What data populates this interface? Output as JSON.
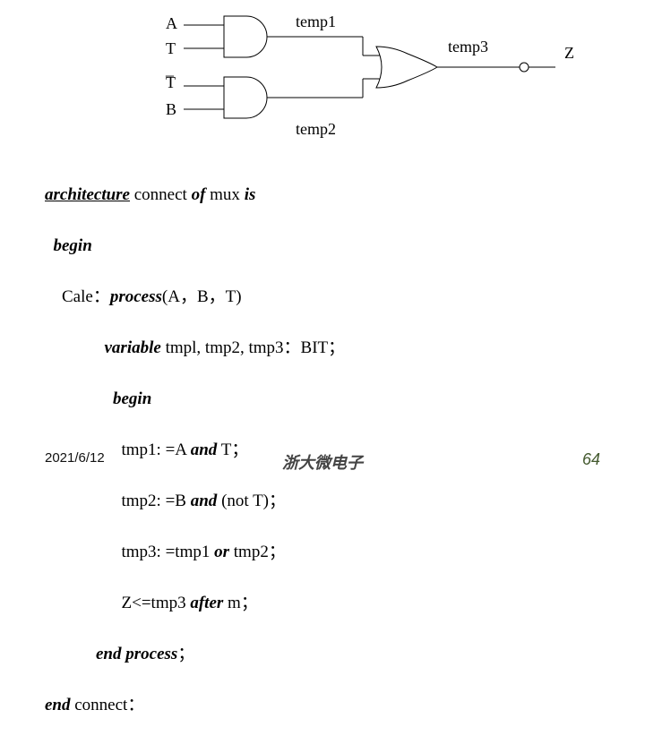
{
  "diagram": {
    "inputs": {
      "A": "A",
      "T": "T",
      "TbarTop": "_",
      "Tbar": "T",
      "B": "B"
    },
    "signals": {
      "temp1": "temp1",
      "temp2": "temp2",
      "temp3": "temp3"
    },
    "output": "Z"
  },
  "code": {
    "kw_architecture": "architecture",
    "txt_connect": " connect ",
    "kw_of": "of",
    "txt_mux": " mux ",
    "kw_is": "is",
    "kw_begin1": "begin",
    "txt_cale": "Cale：",
    "kw_process": "process",
    "txt_processargs": "(A，B，T)",
    "kw_variable": "variable",
    "txt_vars": " tmpl, tmp2, tmp3：BIT；",
    "kw_begin2": "begin",
    "txt_tmp1a": "tmp1: =A ",
    "kw_and1": "and",
    "txt_tmp1b": " T；",
    "txt_tmp2a": "tmp2: =B ",
    "kw_and2": "and",
    "txt_tmp2b": " (not T)；",
    "txt_tmp3a": "tmp3: =tmp1 ",
    "kw_or": "or",
    "txt_tmp3b": " tmp2；",
    "txt_za": "Z<=tmp3 ",
    "kw_after": "after",
    "txt_zb": " m；",
    "kw_endprocess": "end process",
    "txt_semicolon1": "；",
    "kw_end": "end",
    "txt_endconnect": " connect：",
    "ind1": "  ",
    "ind2": "    ",
    "ind_var": "              ",
    "ind_beg": "                ",
    "ind_stmt": "                  ",
    "ind_endp": "            "
  },
  "footer": {
    "date": "2021/6/12",
    "center": "浙大微电子",
    "page": "64"
  }
}
